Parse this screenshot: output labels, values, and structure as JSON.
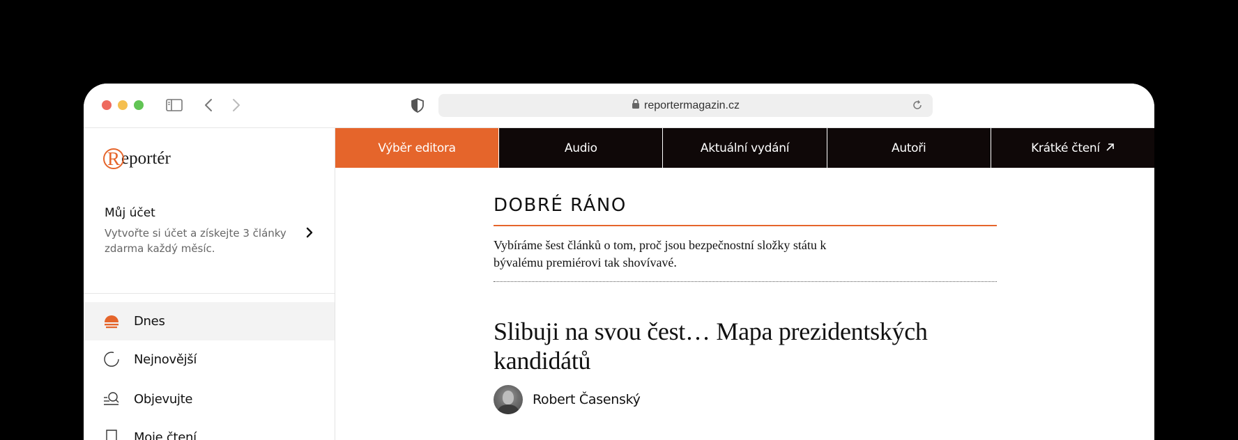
{
  "browser": {
    "url": "reportermagazin.cz"
  },
  "sidebar": {
    "logo": "Reportér",
    "account": {
      "title": "Můj účet",
      "subtitle": "Vytvořte si účet a získejte 3 články zdarma každý měsíc."
    },
    "items": [
      {
        "label": "Dnes",
        "icon": "sun-icon",
        "active": true
      },
      {
        "label": "Nejnovější",
        "icon": "clock-circle-icon",
        "active": false
      },
      {
        "label": "Objevujte",
        "icon": "discover-search-icon",
        "active": false
      },
      {
        "label": "Moje čtení",
        "icon": "bookmark-icon",
        "active": false
      }
    ]
  },
  "nav": {
    "tabs": [
      {
        "label": "Výběr editora",
        "active": true
      },
      {
        "label": "Audio",
        "active": false
      },
      {
        "label": "Aktuální vydání",
        "active": false
      },
      {
        "label": "Autoři",
        "active": false
      },
      {
        "label": "Krátké čtení",
        "active": false,
        "external": true
      }
    ]
  },
  "main": {
    "section_title": "DOBRÉ RÁNO",
    "lead": "Vybíráme šest článků o tom, proč jsou bezpečnostní složky státu k bývalému premiérovi tak shovívavé.",
    "article": {
      "headline": "Slibuji na svou čest… Mapa prezidentských kandidátů",
      "author": "Robert Časenský"
    }
  },
  "colors": {
    "accent": "#e5652b",
    "nav_bg": "#0f0808"
  }
}
